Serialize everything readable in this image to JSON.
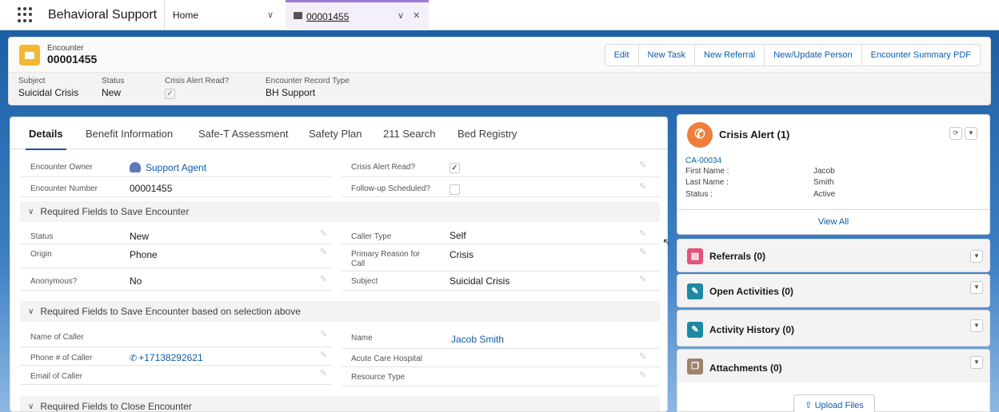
{
  "topnav": {
    "app_name": "Behavioral Support",
    "home_tab": "Home",
    "record_tab": "00001455",
    "record_tab_controls": "∨ ✕"
  },
  "highlights": {
    "object_type": "Encounter",
    "record_name": "00001455",
    "actions": [
      "Edit",
      "New Task",
      "New Referral",
      "New/Update Person",
      "Encounter Summary PDF"
    ],
    "fields": [
      {
        "label": "Subject",
        "value": "Suicidal Crisis"
      },
      {
        "label": "Status",
        "value": "New"
      },
      {
        "label": "Crisis Alert Read?",
        "checked": true
      },
      {
        "label": "Encounter Record Type",
        "value": "BH Support"
      }
    ]
  },
  "tabs": [
    "Details",
    "Benefit Information",
    "Safe-T Assessment",
    "Safety Plan",
    "211 Search",
    "Bed Registry"
  ],
  "details": {
    "top_left": [
      {
        "label": "Encounter Owner",
        "value": "Support Agent",
        "link": true
      },
      {
        "label": "Encounter Number",
        "value": "00001455"
      }
    ],
    "top_right": [
      {
        "label": "Crisis Alert Read?",
        "checked": true
      },
      {
        "label": "Follow-up Scheduled?",
        "checked": false
      }
    ],
    "section1": {
      "title": "Required Fields to Save Encounter",
      "left": [
        {
          "label": "Status",
          "value": "New"
        },
        {
          "label": "Origin",
          "value": "Phone"
        },
        {
          "label": "Anonymous?",
          "value": "No"
        }
      ],
      "right": [
        {
          "label": "Caller Type",
          "value": "Self"
        },
        {
          "label": "Primary Reason for Call",
          "value": "Crisis"
        },
        {
          "label": "Subject",
          "value": "Suicidal Crisis"
        }
      ]
    },
    "section2": {
      "title": "Required Fields to Save Encounter based on selection above",
      "left": [
        {
          "label": "Name of Caller",
          "value": ""
        },
        {
          "label": "Phone # of Caller",
          "value": "+17138292621"
        },
        {
          "label": "Email of Caller",
          "value": ""
        }
      ],
      "right": [
        {
          "label": "Name",
          "value": "Jacob Smith"
        },
        {
          "label": "Acute Care Hospital",
          "value": ""
        },
        {
          "label": "Resource Type",
          "value": ""
        }
      ]
    },
    "section3": {
      "title": "Required Fields to Close Encounter"
    }
  },
  "sidebar": {
    "crisis_alert": {
      "title": "Crisis Alert (1)",
      "record": "CA-00034",
      "fields": [
        {
          "label": "First Name :",
          "value": "Jacob"
        },
        {
          "label": "Last Name :",
          "value": "Smith"
        },
        {
          "label": "Status :",
          "value": "Active"
        }
      ],
      "view_all": "View All"
    },
    "related": [
      {
        "title": "Referrals (0)",
        "icon": "referrals-icon",
        "color": "#e3537a"
      },
      {
        "title": "Open Activities (0)",
        "icon": "wrench-icon",
        "color": "#1d8aa5"
      },
      {
        "title": "Activity History (0)",
        "icon": "wrench-icon",
        "color": "#1d8aa5"
      },
      {
        "title": "Attachments (0)",
        "icon": "attachment-icon",
        "color": "#a0836a"
      }
    ],
    "upload_label": "Upload Files"
  }
}
